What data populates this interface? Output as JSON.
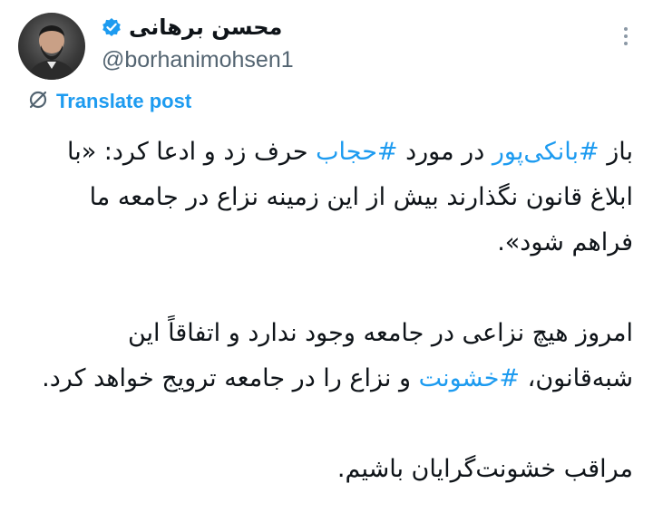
{
  "author": {
    "name": "محسن برهانی",
    "handle": "@borhanimohsen1",
    "verified": true
  },
  "icons": {
    "verified": "verified-badge-icon",
    "more": "more-options-icon",
    "translate": "translate-icon"
  },
  "colors": {
    "link": "#1d9bf0",
    "text": "#0f1419",
    "secondary": "#536471"
  },
  "translate_label": "Translate post",
  "tweet": {
    "p1": {
      "t1": "باز ",
      "h1": "#بانکی‌پور",
      "t2": " در مورد ",
      "h2": "#حجاب",
      "t3": " حرف زد و ادعا کرد: «با ابلاغ قانون نگذارند بیش از این زمینه نزاع در جامعه ما فراهم شود»."
    },
    "p2": {
      "t1": "امروز هیچ نزاعی در جامعه وجود ندارد و اتفاقاً این شبه‌قانون، ",
      "h1": "#خشونت",
      "t2": " و نزاع را در جامعه ترویج خواهد کرد."
    },
    "p3": {
      "t1": "مراقب خشونت‌گرایان باشیم."
    }
  }
}
